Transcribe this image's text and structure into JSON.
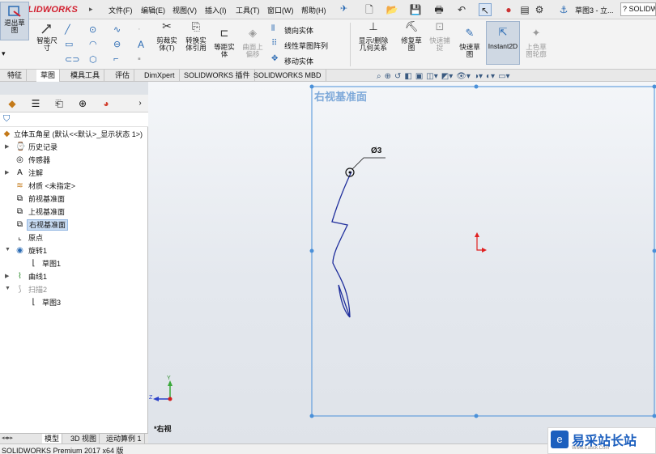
{
  "app": {
    "brand_prefix": "3S",
    "brand_name": "SOLIDWORKS",
    "document_title": "草图3 - 立...",
    "help_search_label": "SOLIDWO"
  },
  "menu": [
    "文件(F)",
    "编辑(E)",
    "视图(V)",
    "插入(I)",
    "工具(T)",
    "窗口(W)",
    "帮助(H)"
  ],
  "ribbon": {
    "sketch_exit": "退出草\n图",
    "smart_dim": "智能尺\n寸",
    "trim": "剪裁实\n体(T)",
    "convert": "转换实\n体引用",
    "offset": "等距实\n体",
    "surface_offset": "曲面上\n偏移",
    "mirror": "镜向实体",
    "linear_pattern": "线性草图阵列",
    "move": "移动实体",
    "show_relations": "显示/删除\n几何关系",
    "repair": "修复草\n图",
    "quick_snap": "快速捕\n捉",
    "rapid_sketch": "快速草\n图",
    "instant2d": "Instant2D",
    "shaded_contours": "上色草\n图轮廓"
  },
  "tabs": [
    {
      "label": "特征",
      "active": false
    },
    {
      "label": "草图",
      "active": true
    },
    {
      "label": "模具工具",
      "active": false
    },
    {
      "label": "评估",
      "active": false
    },
    {
      "label": "DimXpert",
      "active": false
    },
    {
      "label": "SOLIDWORKS 插件",
      "active": false
    },
    {
      "label": "SOLIDWORKS MBD",
      "active": false
    }
  ],
  "tree": {
    "root": "立体五角星 (默认<<默认>_显示状态 1>)",
    "items": [
      {
        "label": "历史记录",
        "icon": "history-icon",
        "expandable": true
      },
      {
        "label": "传感器",
        "icon": "sensor-icon",
        "expandable": false
      },
      {
        "label": "注解",
        "icon": "annotation-icon",
        "expandable": true
      },
      {
        "label": "材质 <未指定>",
        "icon": "material-icon",
        "expandable": false
      },
      {
        "label": "前视基准面",
        "icon": "plane-icon",
        "expandable": false
      },
      {
        "label": "上视基准面",
        "icon": "plane-icon",
        "expandable": false
      },
      {
        "label": "右视基准面",
        "icon": "plane-icon",
        "expandable": false,
        "selected": true
      },
      {
        "label": "原点",
        "icon": "origin-icon",
        "expandable": false
      },
      {
        "label": "旋转1",
        "icon": "revolve-icon",
        "expandable": true,
        "expanded": true
      },
      {
        "label": "草图1",
        "icon": "sketch-icon",
        "child": true
      },
      {
        "label": "曲线1",
        "icon": "curve-icon",
        "expandable": true
      },
      {
        "label": "扫描2",
        "icon": "sweep-icon",
        "expandable": true,
        "expanded": true,
        "gray": true
      },
      {
        "label": "草图3",
        "icon": "sketch-icon",
        "child": true
      }
    ]
  },
  "bottom_tabs": [
    {
      "label": "模型",
      "active": true
    },
    {
      "label": "3D 视图",
      "active": false
    },
    {
      "label": "运动算例 1",
      "active": false
    }
  ],
  "viewport": {
    "plane_label": "右视基准面",
    "dimension": "Ø3",
    "view_name": "*右视",
    "triad": {
      "y": "Y",
      "z": "Z"
    },
    "status_partial": "-4"
  },
  "status": "SOLIDWORKS Premium 2017 x64 版",
  "watermark": {
    "title": "易采站长站",
    "subtitle": "Www.Easck.Com"
  },
  "colors": {
    "accent": "#1c5fbe",
    "plane_border": "#4a90d9",
    "curve": "#1f2e9c",
    "origin": "#e02020"
  }
}
